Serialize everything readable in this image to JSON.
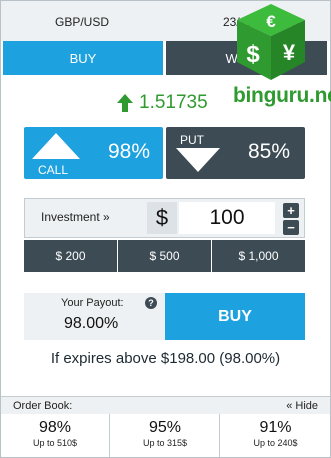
{
  "header": {
    "pair": "GBP/USD",
    "datetime": "23/11/2016 15:47"
  },
  "tabs": [
    {
      "label": "BUY"
    },
    {
      "label": "WRITE"
    }
  ],
  "logo": {
    "text": "binguru.net",
    "icon": "currency-cube-icon"
  },
  "price": {
    "value": "1.51735",
    "direction": "up",
    "color": "#2f9a2f"
  },
  "options": {
    "call": {
      "label": "CALL",
      "percent": "98%"
    },
    "put": {
      "label": "PUT",
      "percent": "85%"
    }
  },
  "investment": {
    "label": "Investment »",
    "currency": "$",
    "amount": "100",
    "plus": "+",
    "minus": "−"
  },
  "quick_amounts": [
    "$ 200",
    "$ 500",
    "$ 1,000"
  ],
  "payout": {
    "label": "Your Payout:",
    "value": "98.00%",
    "help": "?"
  },
  "buy_button": {
    "label": "BUY"
  },
  "expiry_text": "If expires above $198.00 (98.00%)",
  "order_book": {
    "title": "Order Book:",
    "hide_label": "« Hide",
    "entries": [
      {
        "percent": "98%",
        "upto": "Up to 510$"
      },
      {
        "percent": "95%",
        "upto": "Up to 315$"
      },
      {
        "percent": "91%",
        "upto": "Up to 240$"
      }
    ]
  },
  "colors": {
    "accent": "#1ea1df",
    "dark": "#3d4b55",
    "green": "#2f9a2f",
    "panel": "#eef1f3"
  }
}
